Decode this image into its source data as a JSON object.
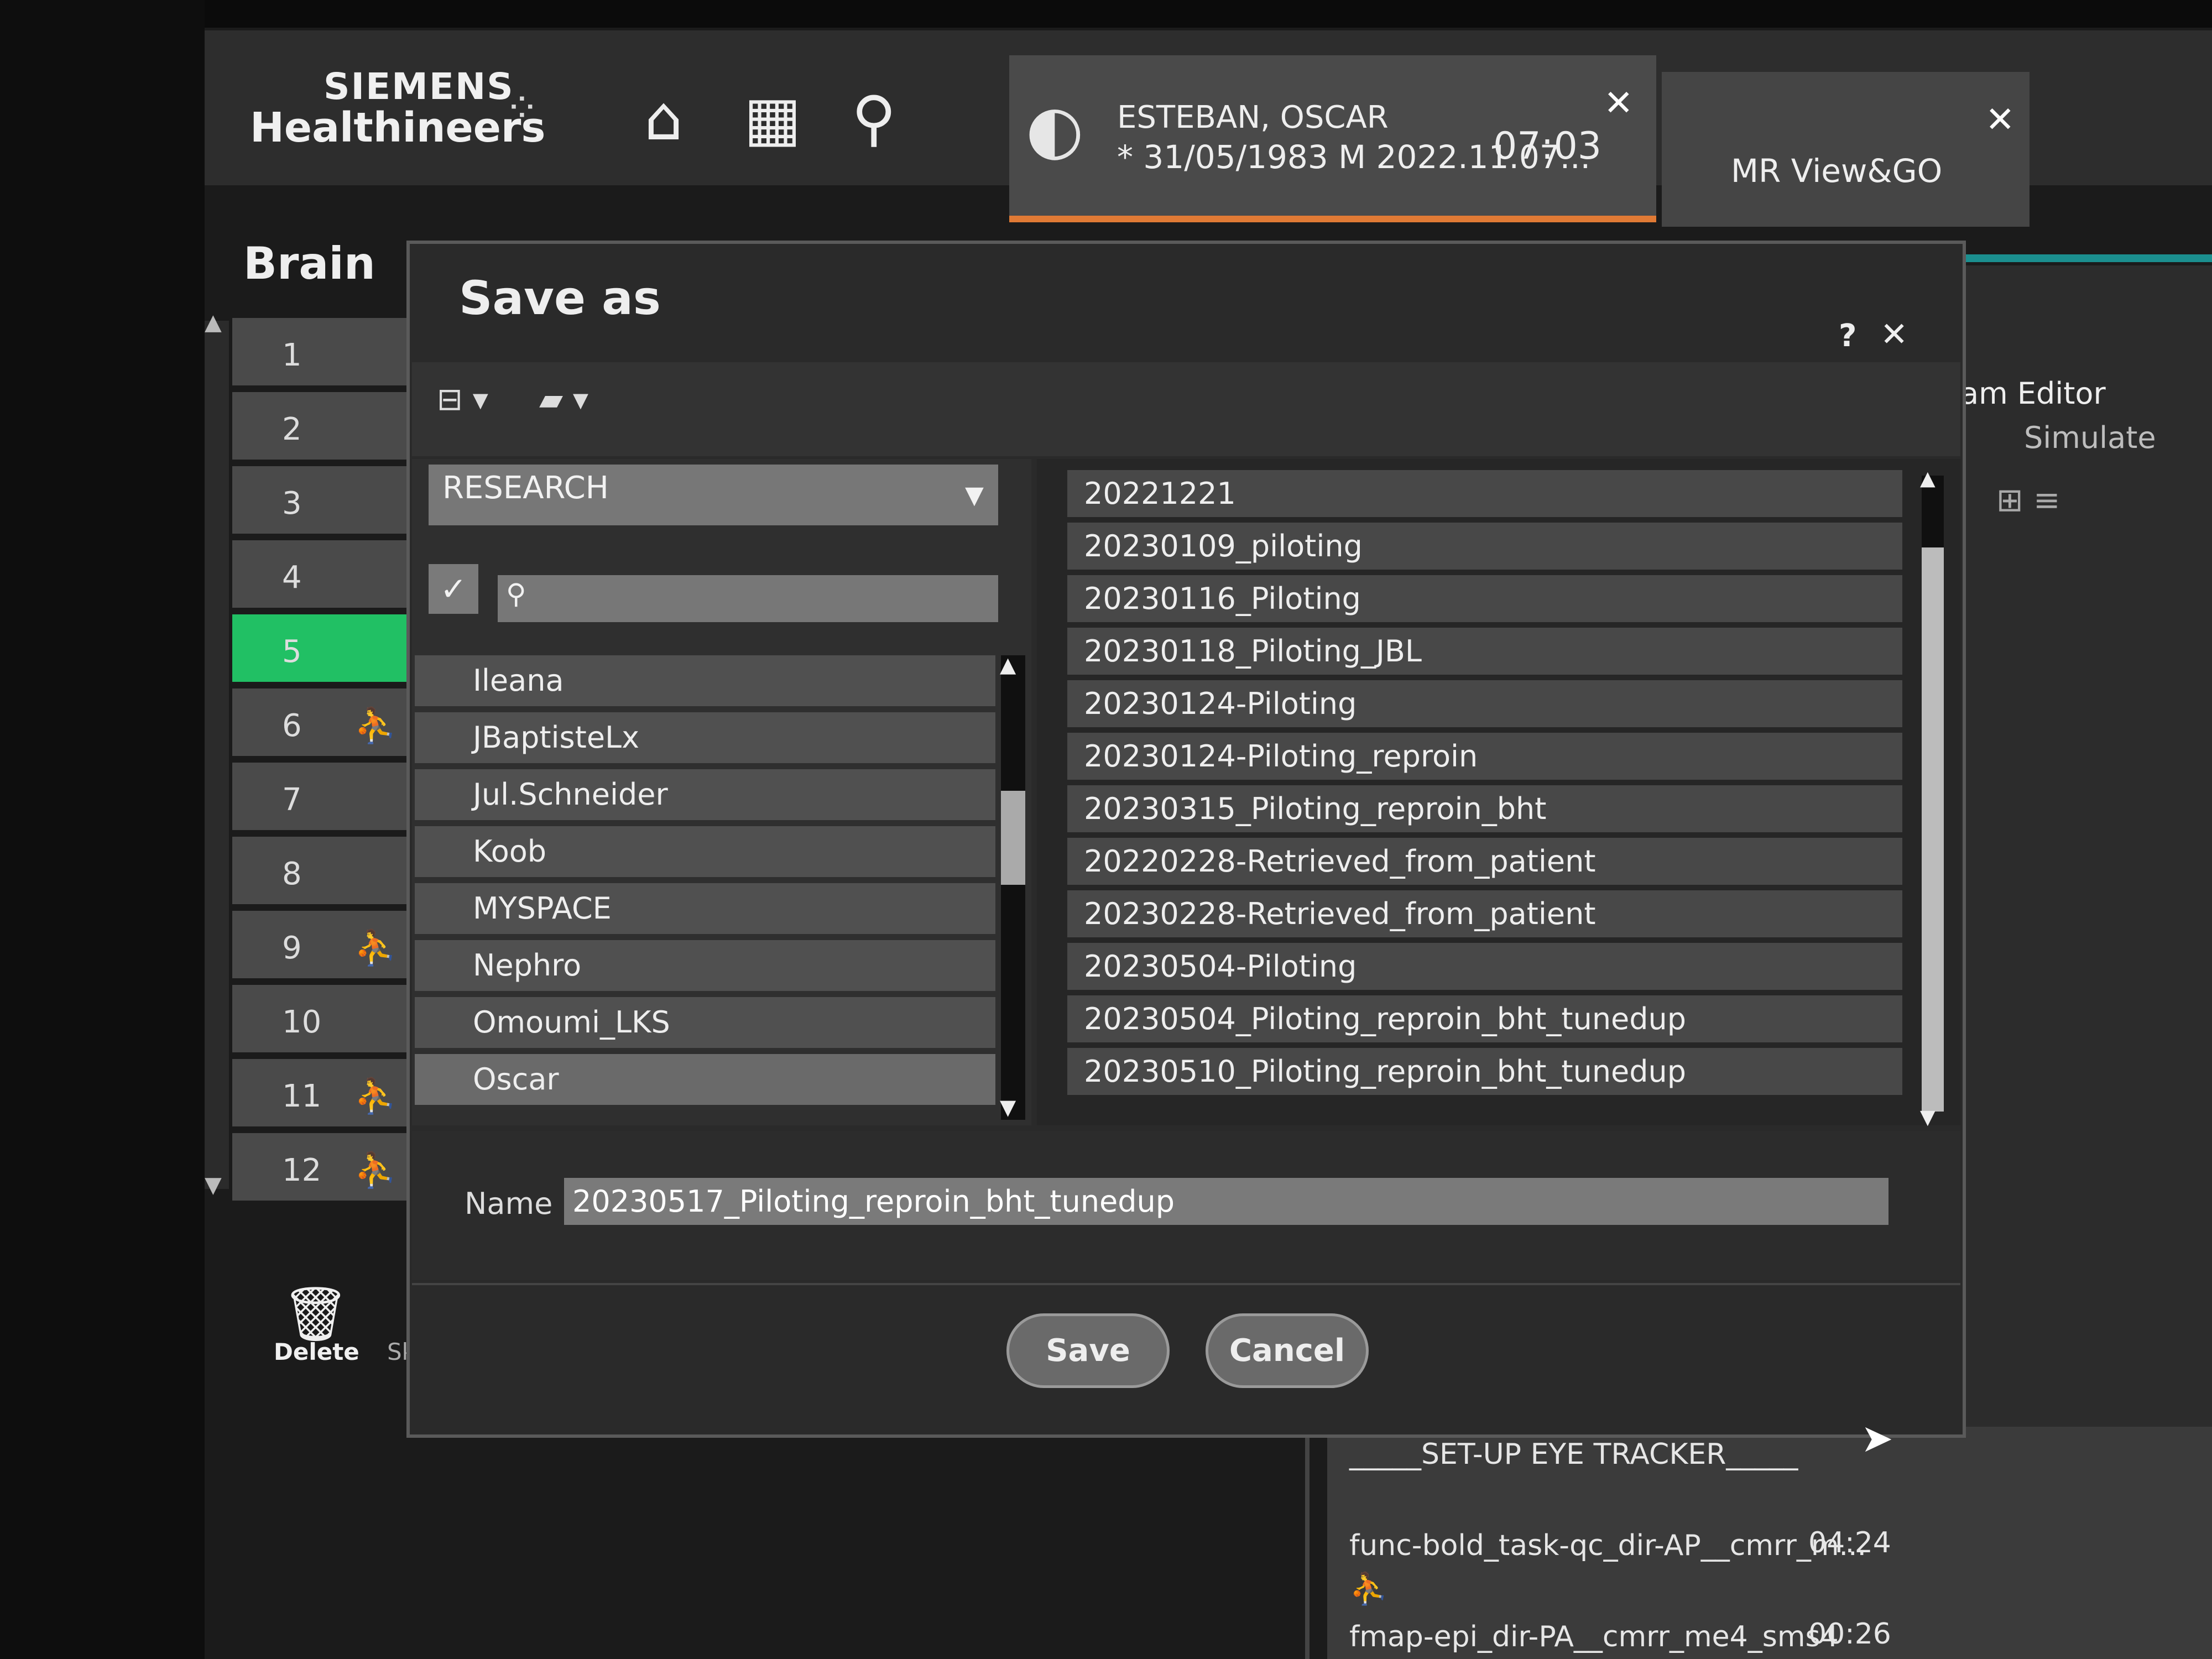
{
  "header": {
    "logo_top": "SIEMENS",
    "logo_bottom": "Healthineers",
    "logo_dots": "⁘",
    "icons": [
      "home-icon",
      "calendar-icon",
      "patient-search-icon"
    ],
    "patient": {
      "name": "ESTEBAN, OSCAR",
      "info": "* 31/05/1983 M 2022.11.07...",
      "time": "07:03",
      "close": "✕"
    },
    "mrview": {
      "label": "MR View&GO",
      "close": "✕"
    }
  },
  "exam": {
    "title": "Brain",
    "steps": [
      {
        "num": "1",
        "icon": ""
      },
      {
        "num": "2",
        "icon": ""
      },
      {
        "num": "3",
        "icon": ""
      },
      {
        "num": "4",
        "icon": ""
      },
      {
        "num": "5",
        "icon": ""
      },
      {
        "num": "6",
        "icon": "⛹"
      },
      {
        "num": "7",
        "icon": ""
      },
      {
        "num": "8",
        "icon": ""
      },
      {
        "num": "9",
        "icon": "⛹"
      },
      {
        "num": "10",
        "icon": ""
      },
      {
        "num": "11",
        "icon": "⛹"
      },
      {
        "num": "12",
        "icon": "⛹"
      }
    ],
    "active_step": "5",
    "delete_label": "Delete",
    "skip_label": "Sk"
  },
  "right_panel": {
    "program_editor": "am Editor",
    "simulate": "Simulate",
    "eye_tracker": "_____SET-UP EYE TRACKER_____",
    "queue": [
      {
        "name": "func-bold_task-qc_dir-AP__cmrr_m...",
        "time": "04:24"
      },
      {
        "name": "fmap-epi_dir-PA__cmrr_me4_sms4",
        "time": "00:26"
      }
    ]
  },
  "dialog": {
    "title": "Save as",
    "help": "?",
    "close": "✕",
    "location": "RESEARCH",
    "search_placeholder": "",
    "users": [
      "Ileana",
      "JBaptisteLx",
      "Jul.Schneider",
      "Koob",
      "MYSPACE",
      "Nephro",
      "Omoumi_LKS",
      "Oscar"
    ],
    "selected_user": "Oscar",
    "folders": [
      "20221221",
      "20230109_piloting",
      "20230116_Piloting",
      "20230118_Piloting_JBL",
      "20230124-Piloting",
      "20230124-Piloting_reproin",
      "20230315_Piloting_reproin_bht",
      "20220228-Retrieved_from_patient",
      "20230228-Retrieved_from_patient",
      "20230504-Piloting",
      "20230504_Piloting_reproin_bht_tunedup",
      "20230510_Piloting_reproin_bht_tunedup"
    ],
    "name_label": "Name",
    "name_value": "20230517_Piloting_reproin_bht_tunedup",
    "save_label": "Save",
    "cancel_label": "Cancel"
  },
  "colors": {
    "active_step": "#21c064",
    "accent_orange": "#e07a35",
    "teal": "#1b8f8f"
  }
}
